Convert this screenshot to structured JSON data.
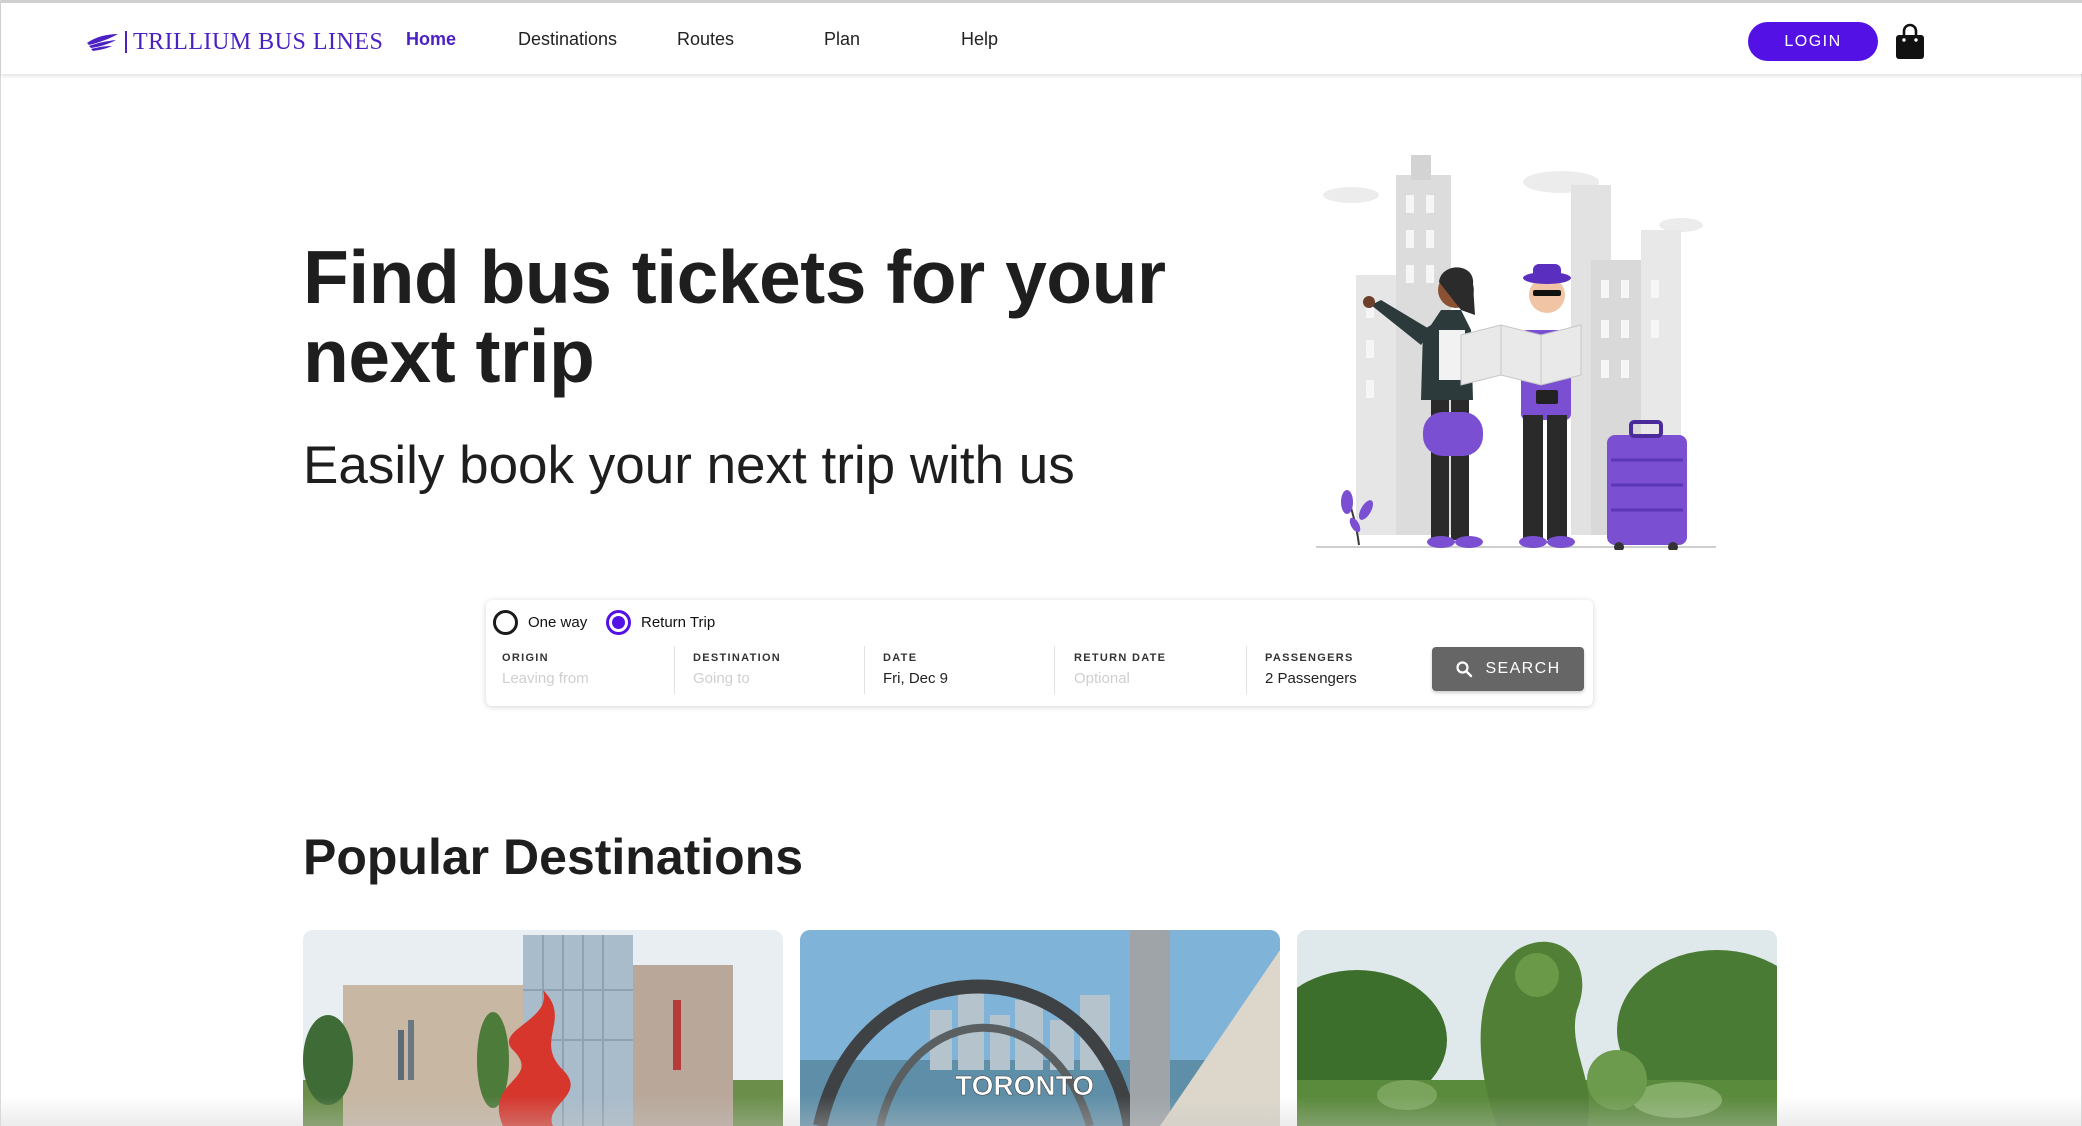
{
  "brand": {
    "name": "TRILLIUM BUS LINES",
    "color": "#4b21c4"
  },
  "nav": {
    "items": [
      {
        "label": "Home",
        "active": true
      },
      {
        "label": "Destinations",
        "active": false
      },
      {
        "label": "Routes",
        "active": false
      },
      {
        "label": "Plan",
        "active": false
      },
      {
        "label": "Help",
        "active": false
      }
    ],
    "login_label": "LOGIN",
    "cart_icon": "shopping-bag-icon"
  },
  "hero": {
    "title": "Find bus tickets for your next trip",
    "subtitle": "Easily book your next trip with us",
    "illustration": "travelers-illustration"
  },
  "search": {
    "trip_types": [
      {
        "label": "One way",
        "selected": false
      },
      {
        "label": "Return Trip",
        "selected": true
      }
    ],
    "fields": {
      "origin": {
        "label": "ORIGIN",
        "placeholder": "Leaving from",
        "value": ""
      },
      "destination": {
        "label": "DESTINATION",
        "placeholder": "Going to",
        "value": ""
      },
      "date": {
        "label": "DATE",
        "value": "Fri, Dec 9"
      },
      "return_date": {
        "label": "RETURN DATE",
        "placeholder": "Optional",
        "value": ""
      },
      "passengers": {
        "label": "PASSENGERS",
        "value": "2 Passengers"
      }
    },
    "button_label": "SEARCH",
    "button_icon": "search-icon"
  },
  "popular": {
    "title": "Popular Destinations"
  },
  "colors": {
    "accent": "#5411e5",
    "search_button": "#666666",
    "text": "#1e1e1e"
  }
}
